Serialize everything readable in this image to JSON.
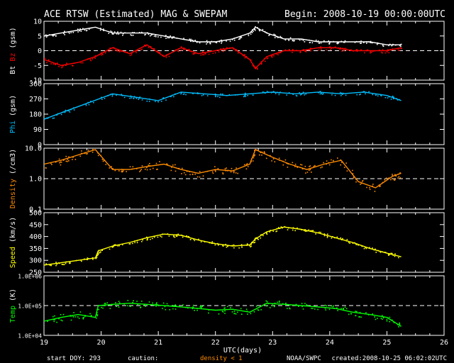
{
  "header": {
    "title": "ACE RTSW (Estimated) MAG & SWEPAM",
    "begin": "Begin: 2008-10-19 00:00:00UTC"
  },
  "footer": {
    "start_doy": "start DOY: 293",
    "caution": "caution:",
    "density_note": "density < 1",
    "agency": "NOAA/SWPC",
    "created": "created:2008-10-25 06:02:02UTC"
  },
  "colors": {
    "background": "#000000",
    "axes": "#ffffff",
    "bt": "#ffffff",
    "bz": "#ff0000",
    "phi": "#00bfff",
    "density": "#ff8c00",
    "speed": "#ffff00",
    "temp": "#00ff00"
  },
  "chart_data": {
    "type": "scatter",
    "title": "ACE RTSW (Estimated) MAG & SWEPAM",
    "xlabel": "UTC(days)",
    "x_ticks": [
      "19",
      "20",
      "21",
      "22",
      "23",
      "24",
      "25",
      "26"
    ],
    "xlim": [
      19,
      26
    ],
    "panels": [
      {
        "id": "mag",
        "ylabel_parts": [
          "Bt",
          "Bz",
          "(gsm)"
        ],
        "ylim": [
          -10,
          10
        ],
        "y_ticks": [
          "10",
          "5",
          "0",
          "-5",
          "-10"
        ],
        "y_tick_values": [
          10,
          5,
          0,
          -5,
          -10
        ],
        "dashed_ref": 0,
        "series": [
          {
            "name": "Bt",
            "x": [
              19.0,
              19.3,
              19.6,
              19.9,
              20.2,
              20.5,
              20.8,
              21.1,
              21.4,
              21.7,
              22.0,
              22.3,
              22.6,
              22.7,
              22.9,
              23.2,
              23.5,
              23.8,
              24.1,
              24.4,
              24.7,
              25.0,
              25.25
            ],
            "y": [
              5,
              6,
              7,
              8,
              6,
              6,
              6,
              5,
              4,
              3,
              3,
              4,
              6,
              8,
              6,
              4,
              4,
              3,
              3,
              3,
              3,
              2,
              2
            ]
          },
          {
            "name": "Bz",
            "x": [
              19.0,
              19.3,
              19.6,
              19.9,
              20.2,
              20.5,
              20.8,
              21.1,
              21.4,
              21.7,
              22.0,
              22.3,
              22.6,
              22.7,
              22.9,
              23.2,
              23.5,
              23.8,
              24.1,
              24.4,
              24.7,
              25.0,
              25.25
            ],
            "y": [
              -3,
              -5,
              -4,
              -2,
              1,
              -1,
              2,
              -2,
              1,
              -1,
              0,
              1,
              -3,
              -6,
              -2,
              0,
              0,
              1,
              1,
              0,
              0,
              0,
              1
            ]
          }
        ]
      },
      {
        "id": "phi",
        "ylabel_parts": [
          "Phi",
          "(gsm)"
        ],
        "ylim": [
          0,
          360
        ],
        "y_ticks": [
          "360",
          "270",
          "180",
          "90",
          "0"
        ],
        "y_tick_values": [
          360,
          270,
          180,
          90,
          0
        ],
        "series": [
          {
            "name": "Phi",
            "x": [
              19.0,
              19.4,
              19.8,
              20.2,
              20.6,
              21.0,
              21.4,
              21.8,
              22.2,
              22.6,
              23.0,
              23.4,
              23.8,
              24.2,
              24.6,
              25.0,
              25.25
            ],
            "y": [
              150,
              200,
              250,
              300,
              280,
              260,
              310,
              300,
              290,
              300,
              310,
              300,
              310,
              300,
              310,
              290,
              260
            ]
          }
        ]
      },
      {
        "id": "density",
        "ylabel_parts": [
          "Density",
          "(/cm3)"
        ],
        "log": true,
        "ylim": [
          0.1,
          10
        ],
        "y_ticks": [
          "10.0",
          "1.0",
          "0.1"
        ],
        "y_tick_values": [
          10,
          1,
          0.1
        ],
        "dashed_ref": 1,
        "series": [
          {
            "name": "Density",
            "x": [
              19.0,
              19.3,
              19.6,
              19.9,
              20.2,
              20.5,
              20.8,
              21.1,
              21.4,
              21.7,
              22.0,
              22.3,
              22.6,
              22.7,
              23.0,
              23.3,
              23.6,
              23.9,
              24.2,
              24.5,
              24.8,
              25.1,
              25.25
            ],
            "y": [
              3,
              4,
              6,
              9,
              2,
              2,
              2.5,
              3,
              2,
              1.5,
              2,
              1.8,
              3,
              9,
              5,
              3,
              2,
              3,
              4,
              0.8,
              0.5,
              1.2,
              1.5
            ]
          }
        ]
      },
      {
        "id": "speed",
        "ylabel_parts": [
          "Speed",
          "(km/s)"
        ],
        "ylim": [
          250,
          500
        ],
        "y_ticks": [
          "500",
          "450",
          "400",
          "350",
          "300",
          "250"
        ],
        "y_tick_values": [
          500,
          450,
          400,
          350,
          300,
          250
        ],
        "series": [
          {
            "name": "Speed",
            "x": [
              19.0,
              19.3,
              19.6,
              19.9,
              19.95,
              20.2,
              20.5,
              20.8,
              21.1,
              21.4,
              21.7,
              22.0,
              22.3,
              22.6,
              22.7,
              22.9,
              23.2,
              23.5,
              23.8,
              24.1,
              24.4,
              24.7,
              25.0,
              25.25
            ],
            "y": [
              280,
              290,
              300,
              310,
              340,
              360,
              375,
              395,
              410,
              405,
              385,
              370,
              360,
              365,
              390,
              420,
              440,
              430,
              415,
              395,
              375,
              350,
              330,
              315
            ]
          }
        ]
      },
      {
        "id": "temp",
        "ylabel_parts": [
          "Temp",
          "(K)"
        ],
        "log": true,
        "ylim": [
          10000,
          1000000
        ],
        "y_ticks": [
          "1.0E+06",
          "1.0E+05",
          "1.0E+04"
        ],
        "y_tick_values": [
          1000000,
          100000,
          10000
        ],
        "dashed_ref": 100000,
        "series": [
          {
            "name": "Temp",
            "x": [
              19.0,
              19.3,
              19.6,
              19.9,
              19.95,
              20.2,
              20.5,
              20.8,
              21.1,
              21.4,
              21.7,
              22.0,
              22.3,
              22.6,
              22.9,
              23.2,
              23.5,
              23.8,
              24.1,
              24.4,
              24.7,
              25.0,
              25.25
            ],
            "y": [
              30000,
              40000,
              50000,
              40000,
              100000,
              110000,
              120000,
              110000,
              100000,
              90000,
              80000,
              70000,
              75000,
              60000,
              120000,
              110000,
              100000,
              90000,
              80000,
              60000,
              50000,
              40000,
              20000
            ]
          }
        ]
      }
    ]
  }
}
